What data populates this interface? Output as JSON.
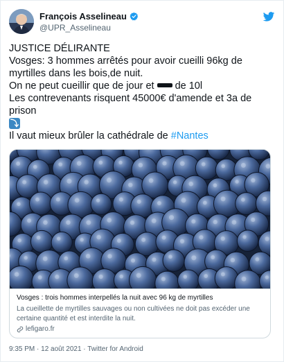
{
  "author": {
    "display_name": "François Asselineau",
    "handle": "@UPR_Asselineau",
    "avatar_icon": "avatar-portrait",
    "verified_icon": "verified-badge-icon",
    "verified_color": "#1d9bf0"
  },
  "header": {
    "logo_icon": "twitter-bird-icon",
    "logo_color": "#1d9bf0"
  },
  "tweet": {
    "line1": "JUSTICE DÉLIRANTE",
    "line2": "Vosges: 3 hommes arrêtés pour avoir cueilli 96kg de",
    "line3": "myrtilles dans les bois,de nuit.",
    "line4_before": "On ne peut cueillir que de jour et",
    "line4_after": "de 10l",
    "line5": "Les contrevenants risquent 45000€ d'amende et 3a de",
    "line6": "prison",
    "line7_arrow": "⤵",
    "line8_before": "Il vaut mieux brûler la cathédrale de ",
    "hashtag": "#Nantes",
    "hashtag_color": "#1d9bf0"
  },
  "card": {
    "title": "Vosges : trois hommes interpellés la nuit avec 96 kg de myrtilles",
    "description": "La cueillette de myrtilles sauvages ou non cultivées ne doit pas excéder une certaine quantité et est interdite la nuit.",
    "domain": "lefigaro.fr",
    "image_subject": "blueberries-photo"
  },
  "meta": {
    "timestamp": "9:35 PM · 12 août 2021 · Twitter for Android"
  }
}
